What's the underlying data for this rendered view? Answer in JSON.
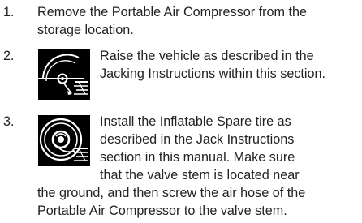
{
  "steps": [
    {
      "number": "1.",
      "lines": [
        "Remove the Portable Air Compressor from the",
        "storage location."
      ]
    },
    {
      "number": "2.",
      "icon": "vehicle-jacking-icon",
      "lines": [
        "Raise the vehicle as described in the",
        "Jacking Instructions within this section."
      ]
    },
    {
      "number": "3.",
      "icon": "inflatable-spare-tire-icon",
      "lines": [
        "Install the Inflatable Spare tire as",
        "described in the Jack Instructions",
        "section in this manual. Make sure",
        "that the valve stem is located near",
        "the ground, and then screw the air hose of the",
        "Portable Air Compressor to the valve stem."
      ]
    }
  ],
  "colors": {
    "text": "#222222",
    "icon_background": "#000000",
    "icon_foreground": "#ffffff"
  }
}
